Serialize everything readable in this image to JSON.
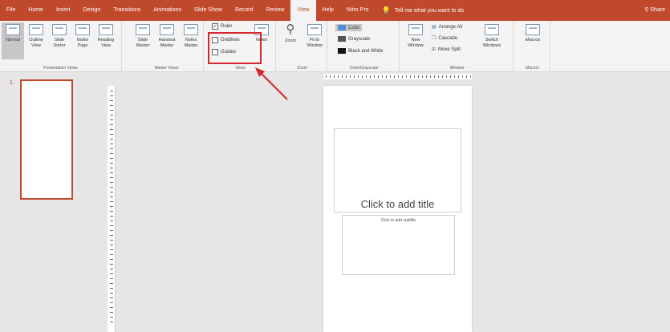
{
  "menu": {
    "tabs": [
      "File",
      "Home",
      "Insert",
      "Design",
      "Transitions",
      "Animations",
      "Slide Show",
      "Record",
      "Review",
      "View",
      "Help",
      "Nitro Pro"
    ],
    "active_tab": "View",
    "tell_me": "Tell me what you want to do",
    "share": "Share"
  },
  "ribbon": {
    "presentation_views": {
      "label": "Presentation Views",
      "buttons": [
        {
          "l1": "Normal",
          "l2": ""
        },
        {
          "l1": "Outline",
          "l2": "View"
        },
        {
          "l1": "Slide",
          "l2": "Sorter"
        },
        {
          "l1": "Notes",
          "l2": "Page"
        },
        {
          "l1": "Reading",
          "l2": "View"
        }
      ]
    },
    "master_views": {
      "label": "Master Views",
      "buttons": [
        {
          "l1": "Slide",
          "l2": "Master"
        },
        {
          "l1": "Handout",
          "l2": "Master"
        },
        {
          "l1": "Notes",
          "l2": "Master"
        }
      ]
    },
    "show": {
      "label": "Show",
      "ruler": "Ruler",
      "gridlines": "Gridlines",
      "guides": "Guides",
      "notes": "Notes"
    },
    "zoom": {
      "label": "Zoom",
      "zoom": "Zoom",
      "fit_l1": "Fit to",
      "fit_l2": "Window"
    },
    "color": {
      "label": "Color/Grayscale",
      "color": "Color",
      "grayscale": "Grayscale",
      "bw": "Black and White",
      "swatch_color": "#4e8fd2",
      "swatch_gray": "#555555",
      "swatch_bw": "#111111"
    },
    "window": {
      "label": "Window",
      "new_l1": "New",
      "new_l2": "Window",
      "arrange": "Arrange All",
      "cascade": "Cascade",
      "split": "Move Split",
      "switch_l1": "Switch",
      "switch_l2": "Windows"
    },
    "macros": {
      "label": "Macros",
      "macros": "Macros"
    }
  },
  "slides": {
    "number": "1",
    "title_placeholder": "Click to add title",
    "subtitle_placeholder": "Click to add subtitle"
  },
  "colors": {
    "accent": "#c0492c",
    "highlight": "#d6252c"
  }
}
